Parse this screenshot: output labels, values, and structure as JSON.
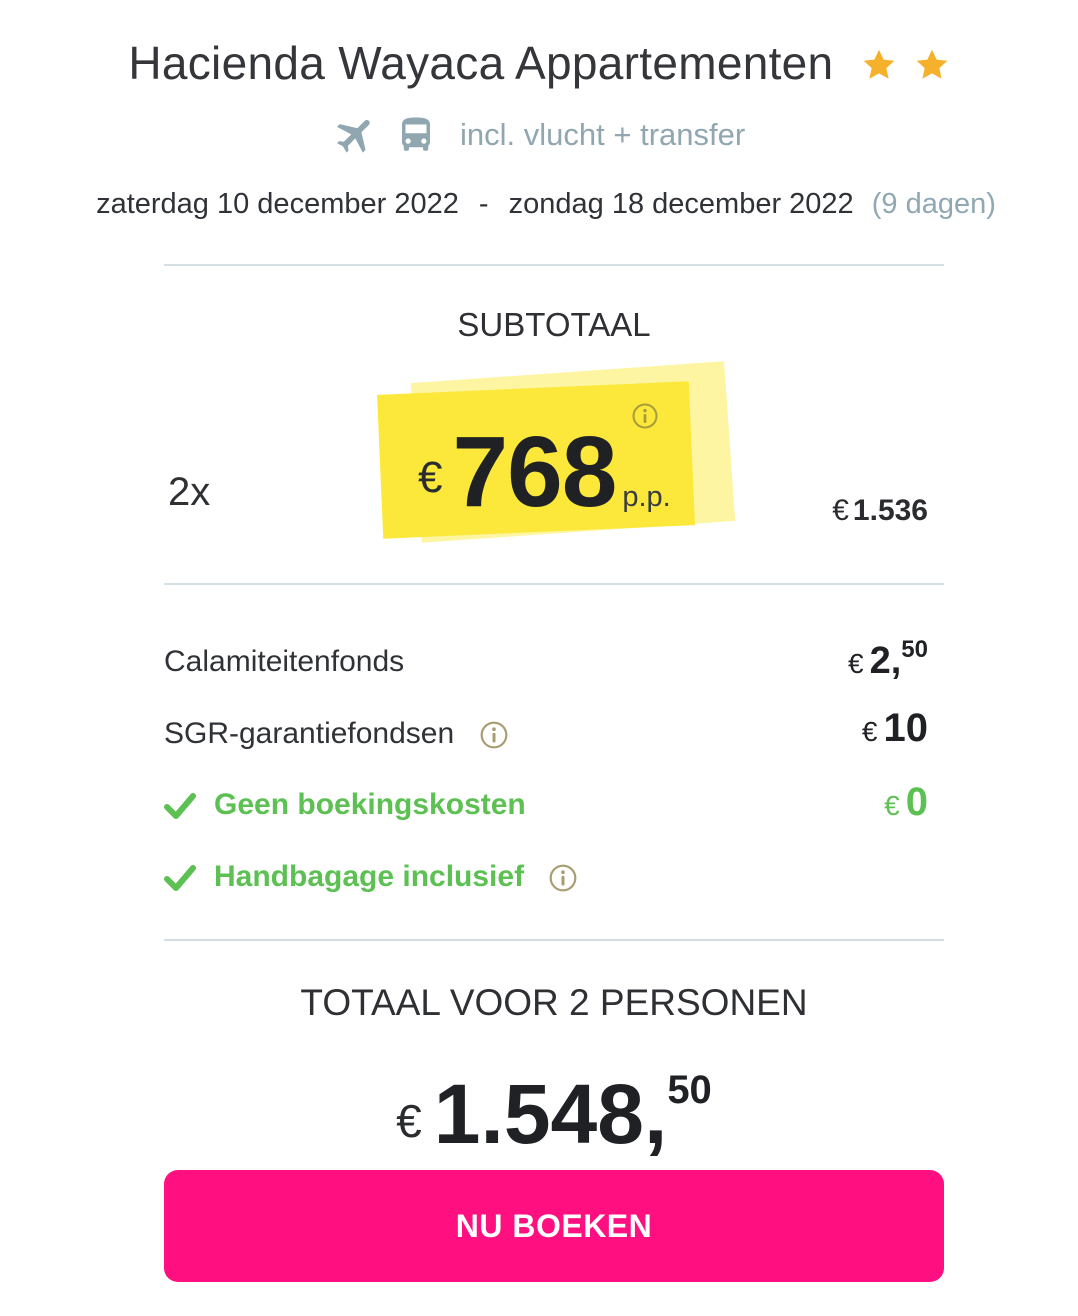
{
  "header": {
    "hotel_name": "Hacienda Wayaca Appartementen",
    "star_rating": 2,
    "star_icons": [
      "star-icon",
      "star-icon"
    ],
    "transport_icons": [
      "plane-icon",
      "bus-icon"
    ],
    "transport_text": "incl. vlucht + transfer",
    "date_from": "zaterdag 10 december 2022",
    "date_separator": "-",
    "date_to": "zondag 18 december 2022",
    "duration": "(9 dagen)"
  },
  "subtotal": {
    "title": "SUBTOTAAL",
    "quantity": "2x",
    "currency": "€",
    "price_per_person": "768",
    "per_person_label": "p.p.",
    "info_icon": "info-icon",
    "total_currency": "€",
    "total": "1.536"
  },
  "fees": [
    {
      "label": "Calamiteitenfonds",
      "currency": "€",
      "amount": "2,",
      "decimals": "50"
    },
    {
      "label": "SGR-garantiefondsen",
      "currency": "€",
      "amount": "10"
    }
  ],
  "included": [
    {
      "label": "Geen boekingskosten",
      "currency": "€",
      "amount": "0",
      "icon": "checkmark-icon"
    },
    {
      "label": "Handbagage inclusief",
      "icon": "checkmark-icon",
      "info_icon": "info-icon"
    }
  ],
  "total": {
    "title": "TOTAAL VOOR 2 PERSONEN",
    "currency": "€",
    "amount": "1.548,",
    "decimals": "50"
  },
  "book_button": {
    "label": "NU BOEKEN"
  },
  "colors": {
    "accent_pink": "#ff0f7f",
    "highlight_yellow": "#fbe83a",
    "included_green": "#5cc053",
    "star_orange": "#f6b12c",
    "muted_blue": "#90a6b0"
  }
}
